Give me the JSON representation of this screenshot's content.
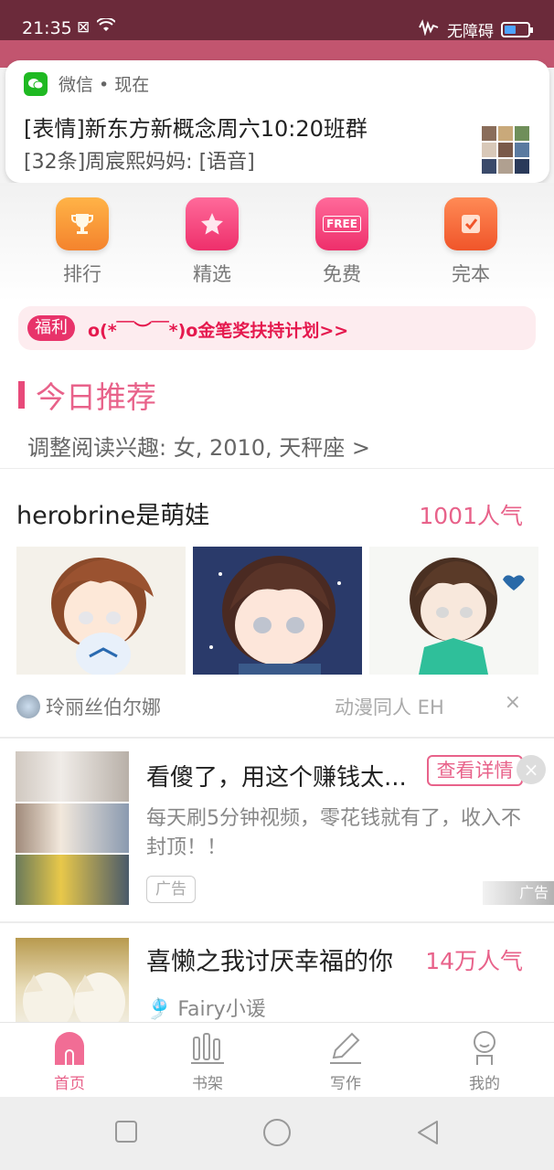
{
  "status_bar": {
    "time": "21:35",
    "accessibility": "无障碍"
  },
  "notification": {
    "app": "微信 • 现在",
    "title": "[表情]新东方新概念周六10:20班群",
    "body": "[32条]周宸熙妈妈: [语音]"
  },
  "categories": [
    {
      "label": "排行",
      "icon": "trophy-icon",
      "color": "#f4972d"
    },
    {
      "label": "精选",
      "icon": "star-icon",
      "color": "#f0437a"
    },
    {
      "label": "免费",
      "icon": "free-icon",
      "icon_text": "FREE",
      "color": "#f0437a"
    },
    {
      "label": "完本",
      "icon": "check-book-icon",
      "color": "#f46a3a"
    }
  ],
  "welfare": {
    "tag": "福利",
    "text": "o(*￣︶￣*)o金笔奖扶持计划>>"
  },
  "recommend": {
    "title": "今日推荐",
    "interest": "调整阅读兴趣: 女, 2010, 天秤座 >"
  },
  "book1": {
    "title": "herobrine是萌娃",
    "popularity": "1001人气",
    "author": "玲丽丝伯尔娜",
    "tags": "动漫同人   EH",
    "close": "×"
  },
  "ad": {
    "title": "看傻了，用这个赚钱太...",
    "button": "查看详情",
    "close": "×",
    "desc": "每天刷5分钟视频，零花钱就有了，收入不封顶！！",
    "label": "广告",
    "corner": "广告"
  },
  "book2": {
    "title": "喜懒之我讨厌幸福的你",
    "popularity": "14万人气",
    "author": "Fairy小谖"
  },
  "bottom_nav": [
    {
      "label": "首页",
      "active": true
    },
    {
      "label": "书架"
    },
    {
      "label": "写作"
    },
    {
      "label": "我的"
    }
  ],
  "accent_color": "#e8628a"
}
